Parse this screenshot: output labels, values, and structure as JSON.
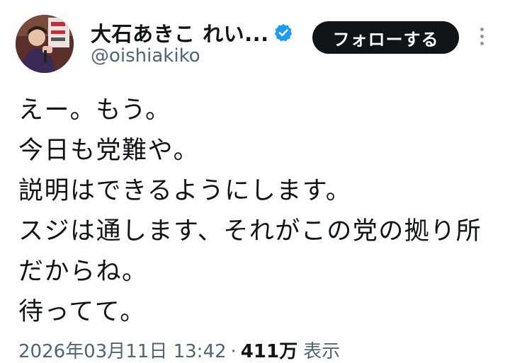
{
  "author": {
    "display_name": "大石あきこ れい...",
    "handle": "@oishiakiko",
    "verified": true,
    "verified_color": "#1d9bf0"
  },
  "actions": {
    "follow_label": "フォローする",
    "more_icon": "more-vertical-icon"
  },
  "tweet": {
    "lines": [
      "えー。もう。",
      "今日も党難や。",
      "説明はできるようにします。",
      "スジは通します、それがこの党の拠り所",
      "だからね。",
      "待ってて。"
    ],
    "timestamp": "2026年03月11日 13:42",
    "separator": "·",
    "views_count": "411万",
    "views_label": "表示"
  }
}
